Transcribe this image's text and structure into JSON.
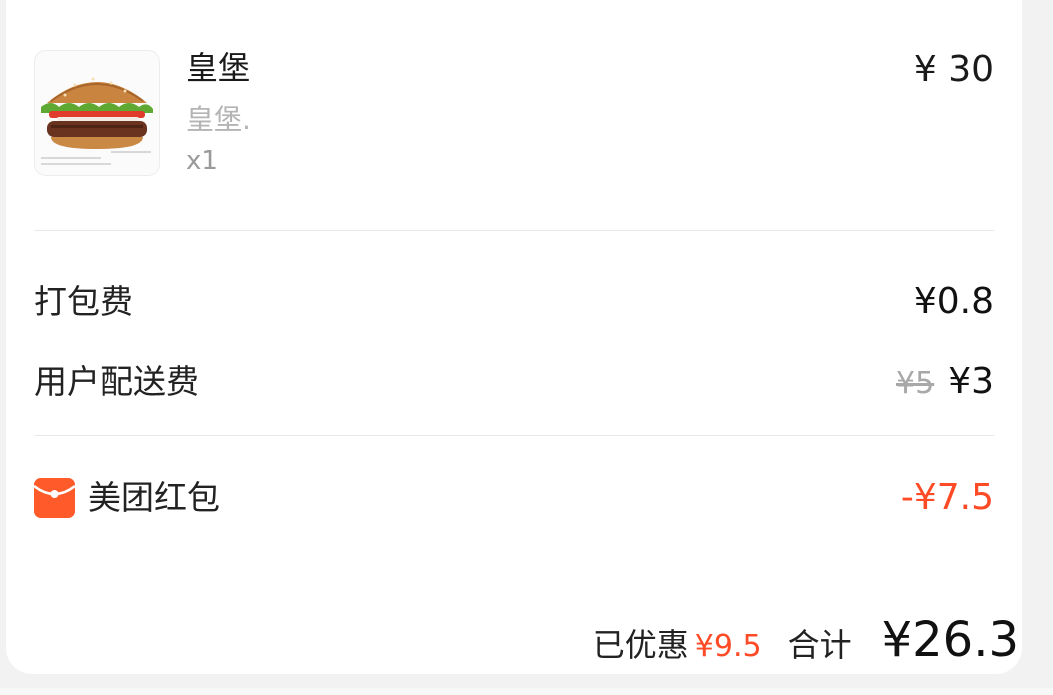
{
  "item": {
    "name": "皇堡",
    "description": "皇堡.",
    "quantity": "x1",
    "price": "¥ 30",
    "image_icon": "burger-image"
  },
  "fees": {
    "packing_label": "打包费",
    "packing_value": "¥0.8",
    "delivery_label": "用户配送费",
    "delivery_original": "¥5",
    "delivery_value": "¥3"
  },
  "red_packet": {
    "icon": "red-envelope-icon",
    "label": "美团红包",
    "value": "-¥7.5"
  },
  "summary": {
    "discount_label": "已优惠",
    "discount_value": "¥9.5",
    "total_label": "合计",
    "total_value": "¥26.3"
  },
  "colors": {
    "accent_red": "#ff4a26",
    "red_packet_bg": "#ff5a2a",
    "page_bg": "#f2f2f2",
    "card_bg": "#ffffff"
  }
}
